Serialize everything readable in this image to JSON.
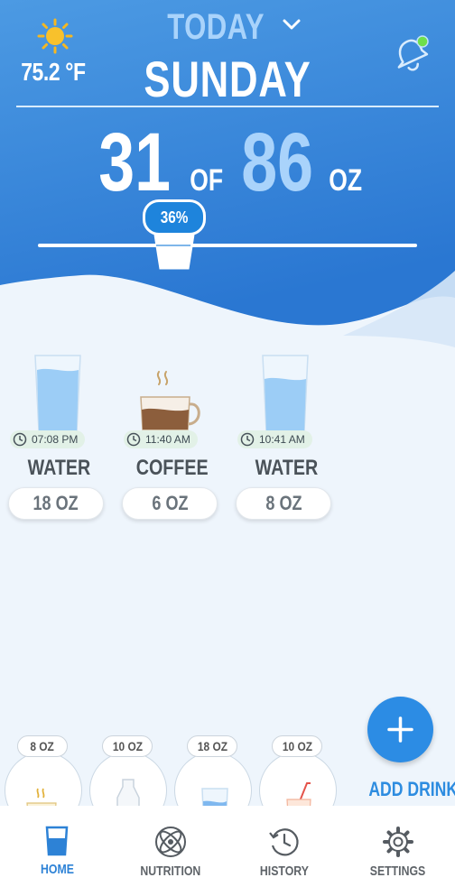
{
  "colors": {
    "accent": "#2c8ce4",
    "header_top": "#4a97e2",
    "header_bottom": "#2b7ad4",
    "water": "#a9d4f8",
    "coffee": "#8c5e3c"
  },
  "weather": {
    "temperature": "75.2 °F",
    "icon": "sun-icon"
  },
  "header": {
    "period": "TODAY",
    "day": "SUNDAY",
    "notification_icon": "bell-icon"
  },
  "progress": {
    "consumed": "31",
    "of": "OF",
    "goal": "86",
    "unit": "OZ",
    "percent_label": "36%",
    "fraction": 0.36
  },
  "log": [
    {
      "time": "07:08 PM",
      "name": "WATER",
      "amount": "18 OZ",
      "icon": "water-glass-icon"
    },
    {
      "time": "11:40 AM",
      "name": "COFFEE",
      "amount": "6 OZ",
      "icon": "coffee-cup-icon"
    },
    {
      "time": "10:41 AM",
      "name": "WATER",
      "amount": "8 OZ",
      "icon": "water-glass-icon"
    }
  ],
  "quick_add": [
    {
      "amount": "8 OZ",
      "icon": "tea-cup-icon"
    },
    {
      "amount": "10 OZ",
      "icon": "milk-bottle-icon"
    },
    {
      "amount": "18 OZ",
      "icon": "water-glass-icon"
    },
    {
      "amount": "10 OZ",
      "icon": "juice-glass-icon"
    }
  ],
  "add_drink": {
    "label": "ADD DRINK"
  },
  "nav": [
    {
      "label": "HOME",
      "icon": "home-glass-icon",
      "active": true
    },
    {
      "label": "NUTRITION",
      "icon": "atom-icon",
      "active": false
    },
    {
      "label": "HISTORY",
      "icon": "history-clock-icon",
      "active": false
    },
    {
      "label": "SETTINGS",
      "icon": "gear-icon",
      "active": false
    }
  ]
}
